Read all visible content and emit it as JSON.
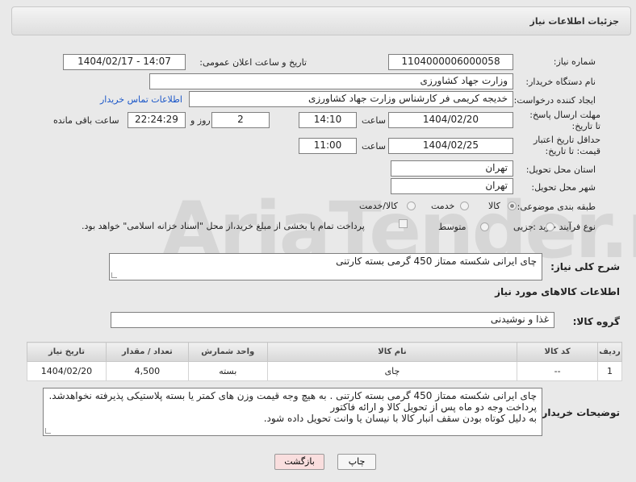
{
  "header": {
    "title": "جزئیات اطلاعات نیاز"
  },
  "watermark": "AriaTender.net",
  "fields": {
    "need_number_label": "شماره نیاز:",
    "need_number": "1104000006000058",
    "announce_label": "تاریخ و ساعت اعلان عمومی:",
    "announce_value": "1404/02/17 - 14:07",
    "buyer_label": "نام دستگاه خریدار:",
    "buyer_value": "وزارت جهاد کشاورزی",
    "creator_label": "ایجاد کننده درخواست:",
    "creator_value": "خدیجه کریمی فر کارشناس وزارت جهاد کشاورزی",
    "contact_link": "اطلاعات تماس خریدار",
    "reply_deadline_label": "مهلت ارسال پاسخ: تا تاریخ:",
    "reply_date": "1404/02/20",
    "time_label": "ساعت",
    "reply_time": "14:10",
    "days_value": "2",
    "days_label": "روز و",
    "remaining_time": "22:24:29",
    "remaining_label": "ساعت باقی مانده",
    "price_validity_label": "حداقل تاریخ اعتبار قیمت: تا تاریخ:",
    "price_date": "1404/02/25",
    "price_time": "11:00",
    "province_label": "استان محل تحویل:",
    "province_value": "تهران",
    "city_label": "شهر محل تحویل:",
    "city_value": "تهران",
    "category_label": "طبقه بندی موضوعی:",
    "category_options": [
      "کالا",
      "خدمت",
      "کالا/خدمت"
    ],
    "process_label": "نوع فرآیند خرید :",
    "process_options": [
      "جزیی",
      "متوسط"
    ],
    "payment_note": "پرداخت تمام یا بخشی از مبلغ خرید،از محل \"اسناد خزانه اسلامی\" خواهد بود."
  },
  "summary": {
    "label": "شرح کلی نیاز:",
    "value": "چای ایرانی شکسته ممتاز 450 گرمی بسته کارتنی"
  },
  "goods_section": {
    "title": "اطلاعات کالاهای مورد نیاز",
    "group_label": "گروه کالا:",
    "group_value": "غذا و نوشیدنی"
  },
  "table": {
    "headers": [
      "ردیف",
      "کد کالا",
      "نام کالا",
      "واحد شمارش",
      "تعداد / مقدار",
      "تاریخ نیاز"
    ],
    "rows": [
      [
        "1",
        "--",
        "چای",
        "بسته",
        "4,500",
        "1404/02/20"
      ]
    ]
  },
  "buyer_notes": {
    "label": "توضیحات خریدار:",
    "lines": [
      "چای ایرانی شکسته ممتاز 450 گرمی بسته کارتنی . به هیچ وجه قیمت وزن های کمتر یا بسته پلاستیکی پذیرفته نخواهدشد.",
      "پرداخت  وجه دو ماه پس از تحویل کالا و ارائه فاکتور",
      "به دلیل کوتاه بودن سقف انبار کالا با نیسان یا وانت تحویل داده شود."
    ]
  },
  "buttons": {
    "print": "چاپ",
    "back": "بازگشت"
  },
  "colors": {
    "link": "#1a56c8",
    "back_button": "#f9dede"
  }
}
